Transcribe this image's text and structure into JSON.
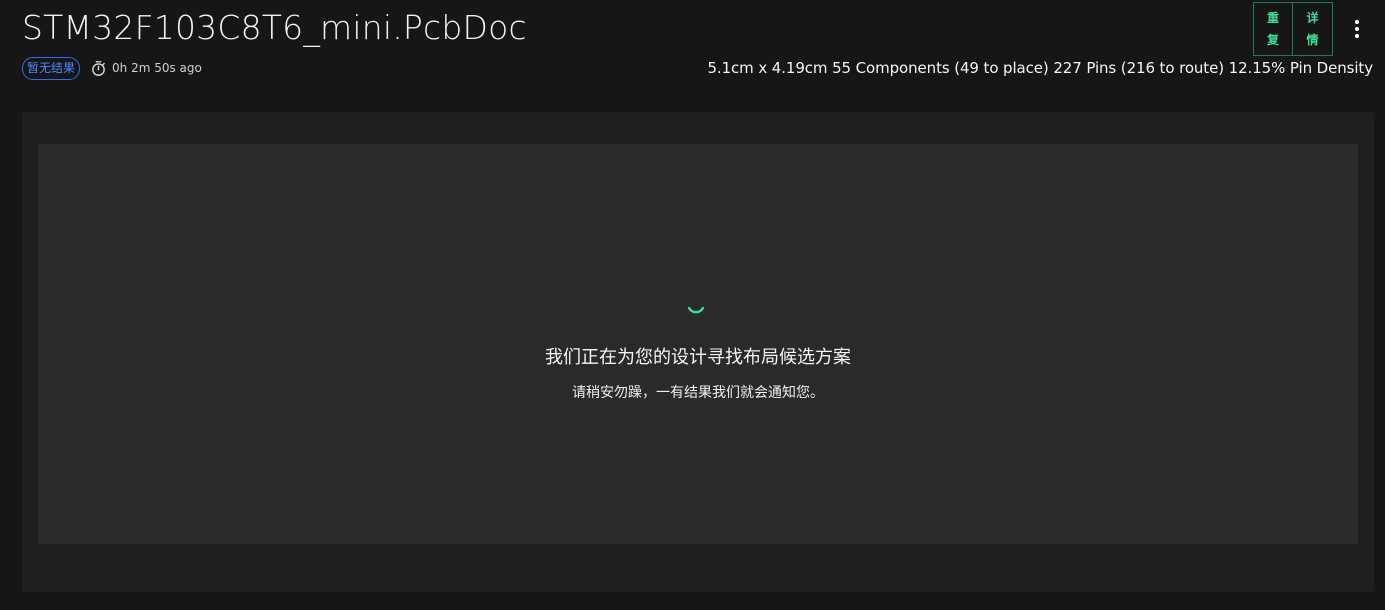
{
  "header": {
    "title": "STM32F103C8T6_mini.PcbDoc",
    "status_badge": "暂无结果",
    "timer_icon": "stopwatch-icon",
    "elapsed": "0h 2m 50s ago",
    "stats": "5.1cm x 4.19cm 55 Components (49 to place) 227 Pins (216 to route) 12.15% Pin Density"
  },
  "actions": {
    "retry": {
      "line1": "重",
      "line2": "复"
    },
    "details": {
      "line1": "详",
      "line2": "情"
    },
    "more_icon": "more-vertical-icon"
  },
  "loading": {
    "spinner_icon": "spinner-icon",
    "title": "我们正在为您的设计寻找布局候选方案",
    "subtitle": "请稍安勿躁，一有结果我们就会通知您。"
  },
  "colors": {
    "background": "#161616",
    "outer_panel": "#1f1f1f",
    "inner_panel": "#2a2a2a",
    "accent_green": "#3ddc97",
    "badge_blue": "#4d86ff"
  }
}
